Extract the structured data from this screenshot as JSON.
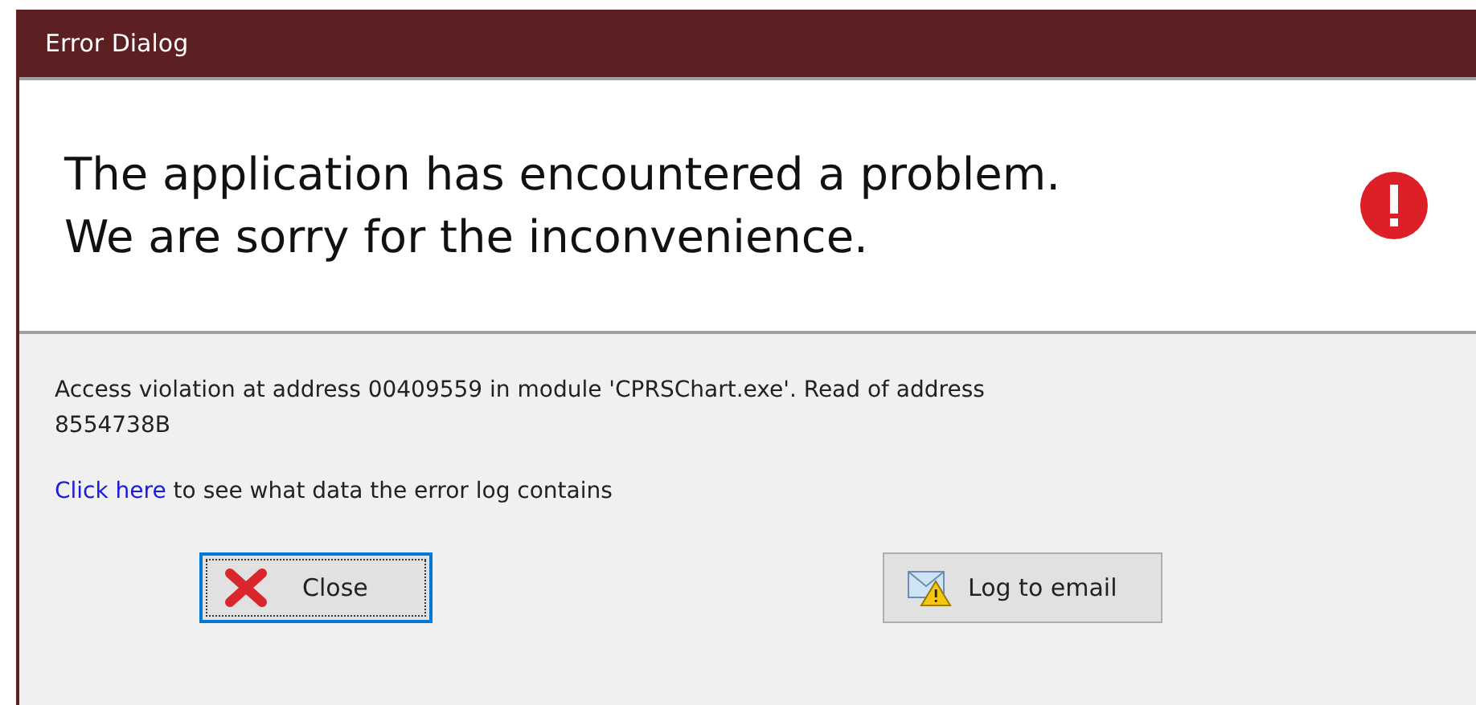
{
  "window": {
    "title": "Error Dialog"
  },
  "header": {
    "lines": [
      "The application has encountered a problem.",
      "We are sorry for the inconvenience."
    ]
  },
  "message": "Access violation at address 00409559 in module 'CPRSChart.exe'. Read of address 8554738B",
  "log_hint": {
    "link": "Click here",
    "text": " to see what data the error log contains"
  },
  "buttons": [
    {
      "label": "Close",
      "kind": "close",
      "focused": true
    },
    {
      "label": "Log to email",
      "kind": "email",
      "focused": false
    }
  ]
}
